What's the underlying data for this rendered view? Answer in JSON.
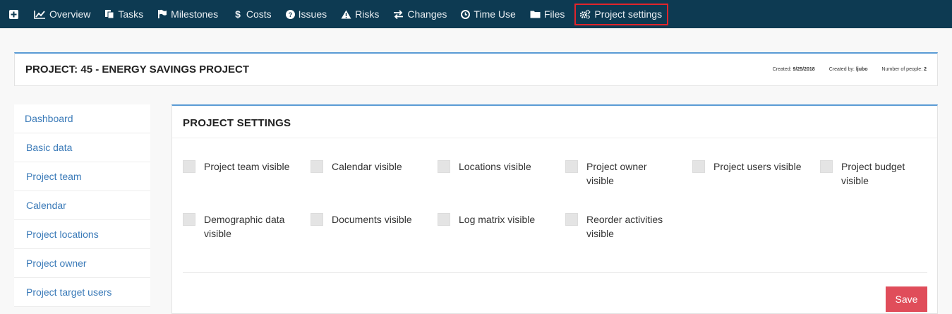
{
  "nav": {
    "items": [
      {
        "label": "Overview",
        "icon": "line-chart-icon"
      },
      {
        "label": "Tasks",
        "icon": "copy-icon"
      },
      {
        "label": "Milestones",
        "icon": "flag-icon"
      },
      {
        "label": "Costs",
        "icon": "dollar-icon"
      },
      {
        "label": "Issues",
        "icon": "question-circle-icon"
      },
      {
        "label": "Risks",
        "icon": "warning-icon"
      },
      {
        "label": "Changes",
        "icon": "exchange-icon"
      },
      {
        "label": "Time Use",
        "icon": "clock-icon"
      },
      {
        "label": "Files",
        "icon": "folder-icon"
      },
      {
        "label": "Project settings",
        "icon": "gears-icon"
      }
    ],
    "highlight_color": "#e0242b"
  },
  "project": {
    "title": "PROJECT: 45 - ENERGY SAVINGS PROJECT",
    "created_label": "Created:",
    "created_value": "9/25/2018",
    "created_by_label": "Created by:",
    "created_by_value": "ljubo",
    "people_label": "Number of people:",
    "people_value": "2"
  },
  "sidebar": {
    "items": [
      {
        "label": "Dashboard"
      },
      {
        "label": "Basic data"
      },
      {
        "label": "Project team"
      },
      {
        "label": "Calendar"
      },
      {
        "label": "Project locations"
      },
      {
        "label": "Project owner"
      },
      {
        "label": "Project target users"
      }
    ]
  },
  "settings": {
    "title": "PROJECT SETTINGS",
    "options": [
      {
        "label": "Project team visible"
      },
      {
        "label": "Calendar visible"
      },
      {
        "label": "Locations visible"
      },
      {
        "label": "Project owner visible"
      },
      {
        "label": "Project users visible"
      },
      {
        "label": "Project budget visible"
      },
      {
        "label": "Demographic data visible"
      },
      {
        "label": "Documents visible"
      },
      {
        "label": "Log matrix visible"
      },
      {
        "label": "Reorder activities visible"
      }
    ],
    "save_label": "Save"
  },
  "colors": {
    "nav_bg": "#0d3a52",
    "accent": "#5a9bd5",
    "link": "#3a7ab8",
    "save_button": "#e04d5a"
  }
}
